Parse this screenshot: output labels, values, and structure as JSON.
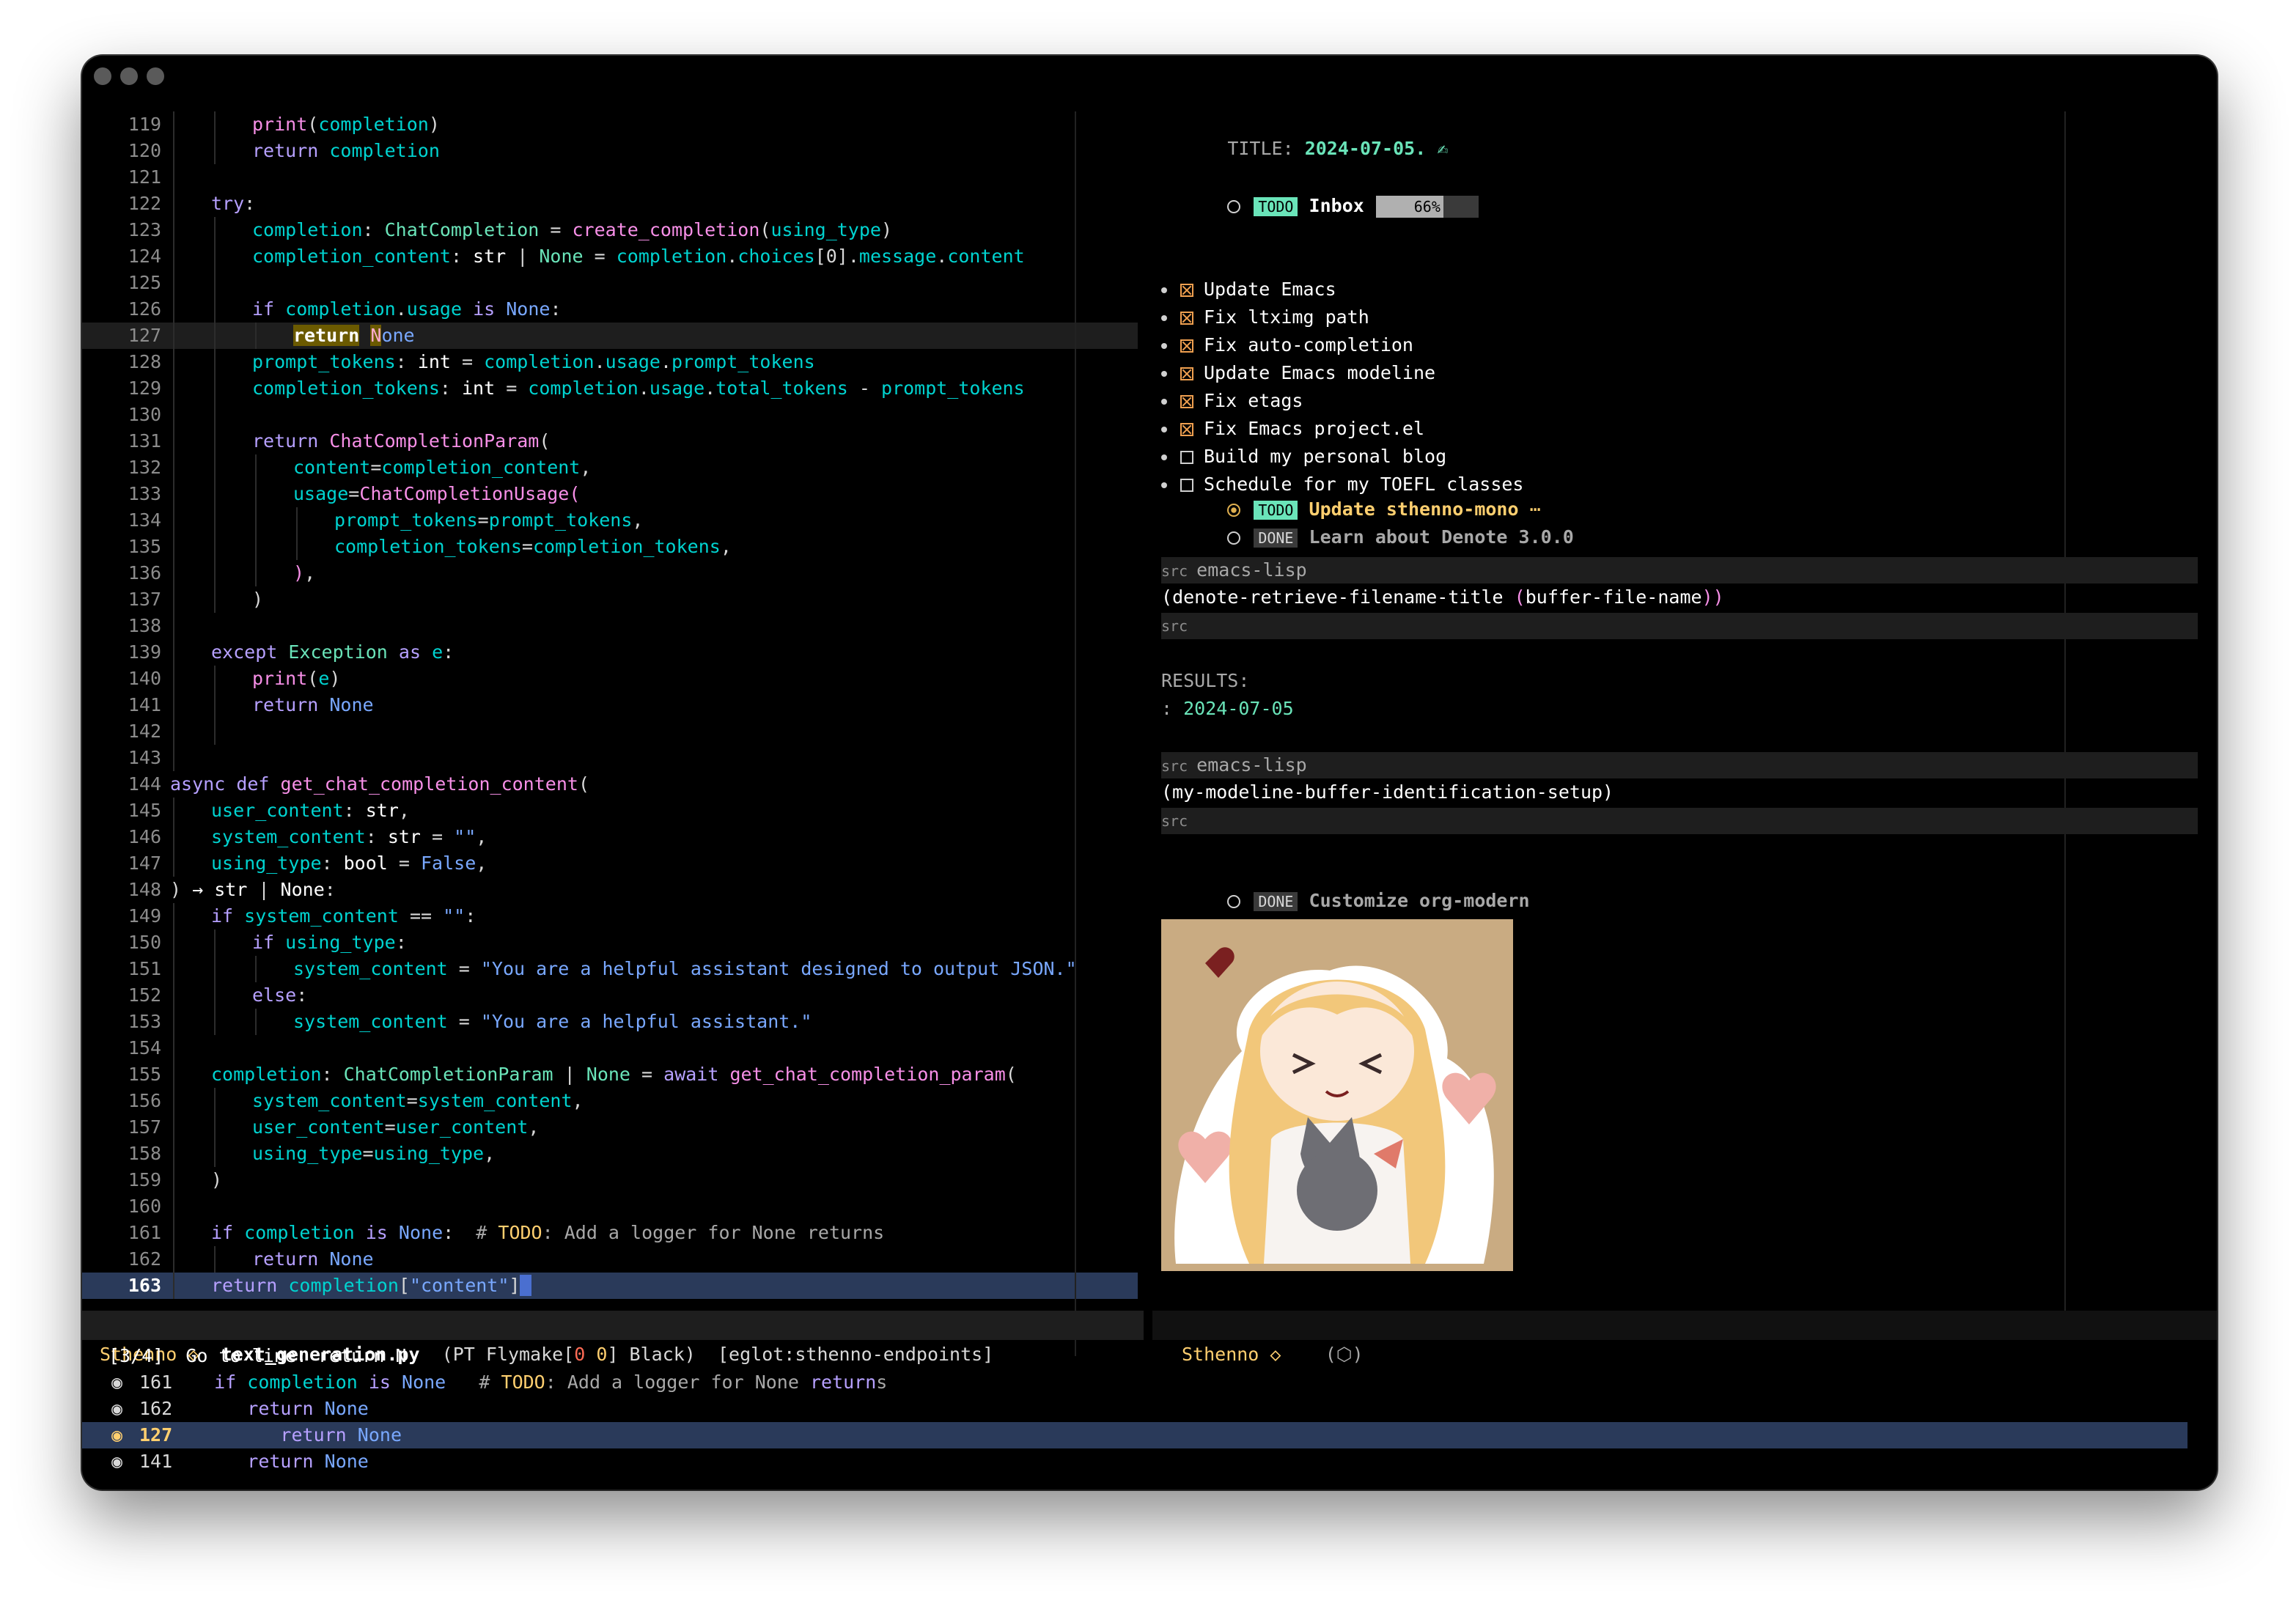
{
  "editor": {
    "lines": [
      {
        "n": "119",
        "i": 2,
        "html": "<span class=\"f\">print</span>(<span class=\"v\">completion</span>)"
      },
      {
        "n": "120",
        "i": 2,
        "html": "<span class=\"k\">return</span> <span class=\"v\">completion</span>"
      },
      {
        "n": "121",
        "i": 1,
        "html": ""
      },
      {
        "n": "122",
        "i": 1,
        "html": "<span class=\"k\">try</span>:"
      },
      {
        "n": "123",
        "i": 2,
        "html": "<span class=\"v\">completion</span>: <span class=\"t\">ChatCompletion</span> = <span class=\"f\">create_completion</span>(<span class=\"v\">using_type</span>)"
      },
      {
        "n": "124",
        "i": 2,
        "html": "<span class=\"v\">completion_content</span>: <span class=\"b\">str</span> | <span class=\"t\">None</span> = <span class=\"v\">completion</span>.<span class=\"v\">choices</span>[0].<span class=\"v\">message</span>.<span class=\"v\">content</span>"
      },
      {
        "n": "125",
        "i": 2,
        "html": ""
      },
      {
        "n": "126",
        "i": 2,
        "html": "<span class=\"k\">if</span> <span class=\"v\">completion</span>.<span class=\"v\">usage</span> <span class=\"k\">is</span> <span class=\"s\">None</span>:"
      },
      {
        "n": "127",
        "i": 3,
        "hl": true,
        "html": "<span class=\"em1\">return</span> <span class=\"em2\">N</span><span class=\"s\">one</span>"
      },
      {
        "n": "128",
        "i": 2,
        "html": "<span class=\"v\">prompt_tokens</span>: <span class=\"b\">int</span> = <span class=\"v\">completion</span>.<span class=\"v\">usage</span>.<span class=\"v\">prompt_tokens</span>"
      },
      {
        "n": "129",
        "i": 2,
        "html": "<span class=\"v\">completion_tokens</span>: <span class=\"b\">int</span> = <span class=\"v\">completion</span>.<span class=\"v\">usage</span>.<span class=\"v\">total_tokens</span> - <span class=\"v\">prompt_tokens</span>"
      },
      {
        "n": "130",
        "i": 2,
        "html": ""
      },
      {
        "n": "131",
        "i": 2,
        "html": "<span class=\"k\">return</span> <span class=\"f\">ChatCompletionParam</span>("
      },
      {
        "n": "132",
        "i": 3,
        "html": "<span class=\"v\">content</span>=<span class=\"v\">completion_content</span>,"
      },
      {
        "n": "133",
        "i": 3,
        "html": "<span class=\"v\">usage</span>=<span class=\"f\">ChatCompletionUsage</span><span class=\"f\">(</span>"
      },
      {
        "n": "134",
        "i": 4,
        "html": "<span class=\"v\">prompt_tokens</span>=<span class=\"v\">prompt_tokens</span>,"
      },
      {
        "n": "135",
        "i": 4,
        "html": "<span class=\"v\">completion_tokens</span>=<span class=\"v\">completion_tokens</span>,"
      },
      {
        "n": "136",
        "i": 3,
        "html": "<span class=\"f\">)</span>,"
      },
      {
        "n": "137",
        "i": 2,
        "html": ")"
      },
      {
        "n": "138",
        "i": 1,
        "html": ""
      },
      {
        "n": "139",
        "i": 1,
        "html": "<span class=\"k\">except</span> <span class=\"t\">Exception</span> <span class=\"k\">as</span> <span class=\"v\">e</span>:"
      },
      {
        "n": "140",
        "i": 2,
        "html": "<span class=\"f\">print</span>(<span class=\"v\">e</span>)"
      },
      {
        "n": "141",
        "i": 2,
        "html": "<span class=\"k\">return</span> <span class=\"s\">None</span>"
      },
      {
        "n": "142",
        "i": 2,
        "html": ""
      },
      {
        "n": "143",
        "i": 1,
        "html": ""
      },
      {
        "n": "144",
        "i": 0,
        "html": "<span class=\"k\">async</span> <span class=\"k\">def</span> <span class=\"f\">get_chat_completion_content</span>("
      },
      {
        "n": "145",
        "i": 1,
        "html": "<span class=\"v\">user_content</span>: <span class=\"b\">str</span>,"
      },
      {
        "n": "146",
        "i": 1,
        "html": "<span class=\"v\">system_content</span>: <span class=\"b\">str</span> = <span class=\"s\">\"\"</span>,"
      },
      {
        "n": "147",
        "i": 1,
        "html": "<span class=\"v\">using_type</span>: <span class=\"b\">bool</span> = <span class=\"s\">False</span>,"
      },
      {
        "n": "148",
        "i": 0,
        "html": ") <span class=\"op\">→</span> <span class=\"b\">str</span> | <span class=\"b\">None</span>:"
      },
      {
        "n": "149",
        "i": 1,
        "html": "<span class=\"k\">if</span> <span class=\"v\">system_content</span> == <span class=\"s\">\"\"</span>:"
      },
      {
        "n": "150",
        "i": 2,
        "html": "<span class=\"k\">if</span> <span class=\"v\">using_type</span>:"
      },
      {
        "n": "151",
        "i": 3,
        "html": "<span class=\"v\">system_content</span> = <span class=\"s\">\"You are a helpful assistant designed to output JSON.\"</span>"
      },
      {
        "n": "152",
        "i": 2,
        "html": "<span class=\"k\">else</span>:"
      },
      {
        "n": "153",
        "i": 3,
        "html": "<span class=\"v\">system_content</span> = <span class=\"s\">\"You are a helpful assistant.\"</span>"
      },
      {
        "n": "154",
        "i": 1,
        "html": ""
      },
      {
        "n": "155",
        "i": 1,
        "html": "<span class=\"v\">completion</span>: <span class=\"t\">ChatCompletionParam</span> | <span class=\"t\">None</span> = <span class=\"k\">await</span> <span class=\"f\">get_chat_completion_param</span>("
      },
      {
        "n": "156",
        "i": 2,
        "html": "<span class=\"v\">system_content</span>=<span class=\"v\">system_content</span>,"
      },
      {
        "n": "157",
        "i": 2,
        "html": "<span class=\"v\">user_content</span>=<span class=\"v\">user_content</span>,"
      },
      {
        "n": "158",
        "i": 2,
        "html": "<span class=\"v\">using_type</span>=<span class=\"v\">using_type</span>,"
      },
      {
        "n": "159",
        "i": 1,
        "html": ")"
      },
      {
        "n": "160",
        "i": 1,
        "html": ""
      },
      {
        "n": "161",
        "i": 1,
        "html": "<span class=\"k\">if</span> <span class=\"v\">completion</span> <span class=\"k\">is</span> <span class=\"s\">None</span>:  <span class=\"cm\"># </span><span class=\"todo\">TODO</span><span class=\"cm\">: Add a logger for None returns</span>"
      },
      {
        "n": "162",
        "i": 2,
        "html": "<span class=\"k\">return</span> <span class=\"s\">None</span>"
      },
      {
        "n": "163",
        "i": 1,
        "cur": true,
        "html": "<span class=\"k\">return</span> <span class=\"v\">completion</span>[<span class=\"s\">\"content\"</span>]<span class=\"cursor\"> </span>"
      }
    ]
  },
  "org": {
    "title_label": "TITLE:",
    "title_value": "2024-07-05.",
    "title_icon": "signature-icon",
    "inbox": {
      "badge": "TODO",
      "label": "Inbox",
      "progress": 66,
      "progress_label": "66%"
    },
    "tasks": [
      {
        "label": "Update Emacs",
        "done": true
      },
      {
        "label": "Fix ltximg path",
        "done": true
      },
      {
        "label": "Fix auto-completion",
        "done": true
      },
      {
        "label": "Update Emacs modeline",
        "done": true
      },
      {
        "label": "Fix etags",
        "done": true
      },
      {
        "label": "Fix Emacs project.el",
        "done": true
      },
      {
        "label": "Build my personal blog",
        "done": false
      },
      {
        "label": "Schedule for my TOEFL classes",
        "done": false
      }
    ],
    "heading2": {
      "badge": "TODO",
      "label": "Update sthenno-mono",
      "ellipsis": "⋯"
    },
    "heading3": {
      "badge": "DONE",
      "label": "Learn about Denote 3.0.0"
    },
    "src1": {
      "begin": "src",
      "lang": "emacs-lisp",
      "end": "src",
      "p1": "(",
      "fn": "denote-retrieve-filename-title",
      "p2": "(",
      "arg": "buffer-file-name",
      "p3": "))"
    },
    "results_label": "RESULTS:",
    "results_prefix": ":",
    "results_value": "2024-07-05",
    "src2": {
      "begin": "src",
      "lang": "emacs-lisp",
      "end": "src",
      "code": "(my-modeline-buffer-identification-setup)"
    },
    "heading4": {
      "badge": "DONE",
      "label": "Customize org-modern"
    }
  },
  "modeline": {
    "left_name": "Sthenno",
    "left_diamond": "◇",
    "filename": "text_generation.py",
    "mode_open": "(PT Flymake[",
    "err": "0",
    "warn": "0",
    "mode_close": "] Black)",
    "eglot": "[eglot:sthenno-endpoints]",
    "right_name": "Sthenno",
    "right_diamond": "◇",
    "right_icon": "(⬡)"
  },
  "minibuffer": {
    "prompt": "[3/4]  Go to line: return N",
    "rows": [
      {
        "n": "161",
        "sel": false,
        "html": "  <span class=\"k\">if</span> <span class=\"v\">completion</span> <span class=\"k\">is</span> <span class=\"s\">None</span>:  <span class=\"cm\"># </span><span class=\"todo\">TODO</span><span class=\"cm\">: Add a logger for None </span><span class=\"k\">return</span><span class=\"cm\">s</span>"
      },
      {
        "n": "162",
        "sel": false,
        "html": "     <span class=\"k\">return</span> <span class=\"s\">None</span>"
      },
      {
        "n": "127",
        "sel": true,
        "html": "        <span class=\"k\">return</span> <span class=\"s\">None</span>"
      },
      {
        "n": "141",
        "sel": false,
        "html": "     <span class=\"k\">return</span> <span class=\"s\">None</span>"
      }
    ]
  }
}
